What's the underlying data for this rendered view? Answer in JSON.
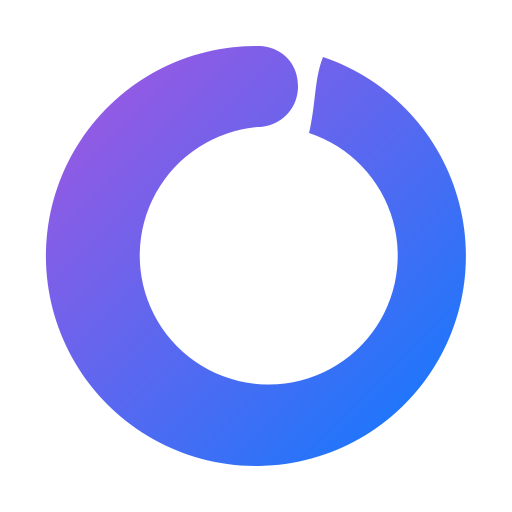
{
  "logo": {
    "icon": "ring-logo-icon",
    "gradient_start_color": "#A855E0",
    "gradient_end_color": "#0A7BFF",
    "background_color": "#FFFFFF"
  }
}
